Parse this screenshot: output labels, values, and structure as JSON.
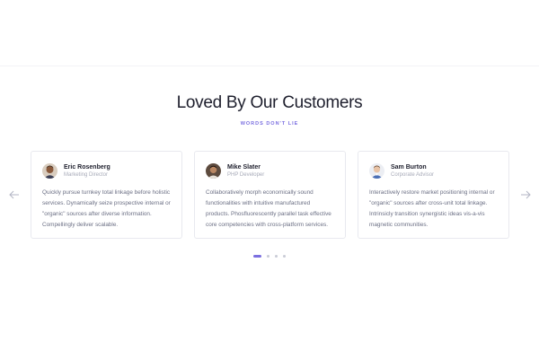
{
  "section": {
    "title": "Loved By Our Customers",
    "subtitle": "WORDS DON'T LIE"
  },
  "carousel": {
    "prev_icon": "arrow-left-icon",
    "next_icon": "arrow-right-icon",
    "testimonials": [
      {
        "name": "Eric Rosenberg",
        "role": "Marketing Director",
        "quote": "Quickly pursue turnkey total linkage before holistic services. Dynamically seize prospective internal or \"organic\" sources after diverse information. Compellingly deliver scalable."
      },
      {
        "name": "Mike Slater",
        "role": "PHP Developer",
        "quote": "Collaboratively morph economically sound functionalities with intuitive manufactured products. Phosfluorescently parallel task effective core competencies with cross-platform services."
      },
      {
        "name": "Sam Burton",
        "role": "Corporate Advisor",
        "quote": "Interactively restore market positioning internal or \"organic\" sources after cross-unit total linkage. Intrinsicly transition synergistic ideas vis-a-vis magnetic communities."
      }
    ]
  },
  "pagination": {
    "count": 4,
    "active_index": 0
  },
  "colors": {
    "accent": "#7b6fe0",
    "heading": "#1e1f2d",
    "body_text": "#6b6f84",
    "muted": "#a7aab8"
  }
}
